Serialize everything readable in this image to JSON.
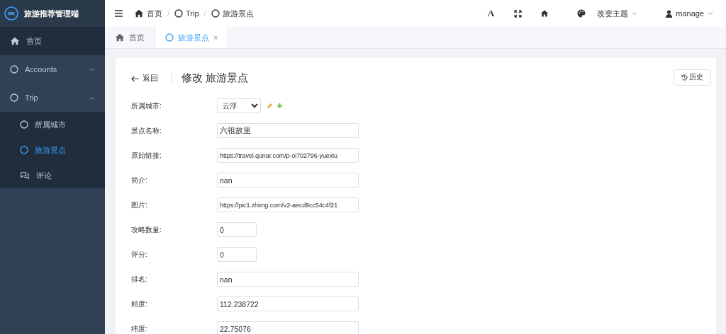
{
  "sidebar": {
    "title": "旅游推荐管理端",
    "items": [
      {
        "label": "首页",
        "kind": "home",
        "selected": false
      },
      {
        "label": "Accounts",
        "kind": "circle",
        "selected": false,
        "expanded": false
      },
      {
        "label": "Trip",
        "kind": "circle",
        "selected": false,
        "expanded": true,
        "children": [
          {
            "label": "所属城市",
            "kind": "circle",
            "selected": false
          },
          {
            "label": "旅游景点",
            "kind": "circle",
            "selected": true
          },
          {
            "label": "评论",
            "kind": "chat",
            "selected": false
          }
        ]
      }
    ]
  },
  "header": {
    "breadcrumbs": [
      {
        "label": "首页",
        "kind": "home"
      },
      {
        "separator": "/",
        "label": "Trip",
        "kind": "circle"
      },
      {
        "separator": "/",
        "label": "旅游景点",
        "kind": "circle"
      }
    ],
    "font_glyph": "A",
    "theme": "改变主题",
    "user": "manage"
  },
  "tabs": [
    {
      "label": "首页",
      "kind": "home",
      "selected": false
    },
    {
      "label": "旅游景点",
      "kind": "circle",
      "selected": true,
      "close": "×"
    }
  ],
  "page": {
    "back": "返回",
    "title": "修改 旅游景点",
    "history": "历史"
  },
  "fields": [
    {
      "label": "所属城市:",
      "kind": "select",
      "value": "云浮"
    },
    {
      "label": "景点名称:",
      "kind": "text",
      "value": "六祖故里"
    },
    {
      "label": "原始链接:",
      "kind": "text",
      "value": "https://travel.qunar.com/p-oi702796-yuexiu"
    },
    {
      "label": "简介:",
      "kind": "text",
      "value": "nan"
    },
    {
      "label": "图片:",
      "kind": "text",
      "value": "https://pic1.zhimg.com/v2-aecd9cc54c4f21"
    },
    {
      "label": "攻略数量:",
      "kind": "short",
      "value": "0"
    },
    {
      "label": "评分:",
      "kind": "short",
      "value": "0"
    },
    {
      "label": "排名:",
      "kind": "text",
      "value": "nan"
    },
    {
      "label": "精度:",
      "kind": "text",
      "value": "112.238722"
    },
    {
      "label": "纬度:",
      "kind": "text",
      "value": "22.75076"
    }
  ]
}
